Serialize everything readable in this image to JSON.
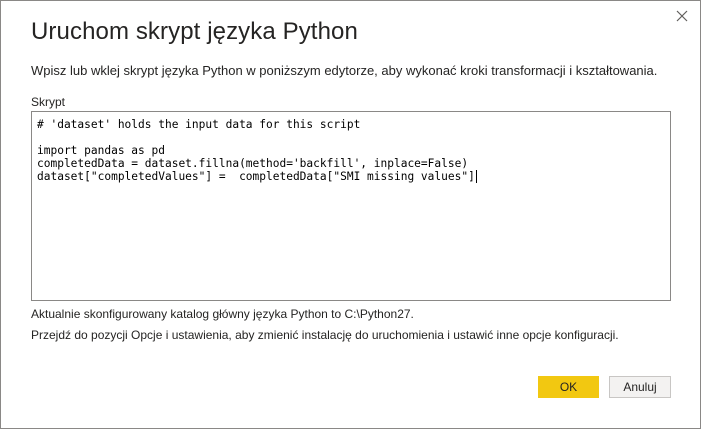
{
  "dialog": {
    "title": "Uruchom skrypt języka Python",
    "description": "Wpisz lub wklej skrypt języka Python w poniższym edytorze, aby wykonać kroki transformacji i kształtowania.",
    "script_label": "Skrypt",
    "close_icon": "close-icon"
  },
  "editor": {
    "lines": [
      "# 'dataset' holds the input data for this script",
      "",
      "import pandas as pd",
      "completedData = dataset.fillna(method='backfill', inplace=False)",
      "dataset[\"completedValues\"] =  completedData[\"SMI missing values\"]"
    ]
  },
  "info": {
    "line1": "Aktualnie skonfigurowany katalog główny języka Python to C:\\Python27.",
    "line2": "Przejdź do pozycji Opcje i ustawienia, aby zmienić instalację do uruchomienia i ustawić inne opcje konfiguracji."
  },
  "buttons": {
    "ok": "OK",
    "cancel": "Anuluj"
  },
  "colors": {
    "ok_button": "#f2c811",
    "cancel_button": "#f3f2f1",
    "border": "#8a8886"
  }
}
